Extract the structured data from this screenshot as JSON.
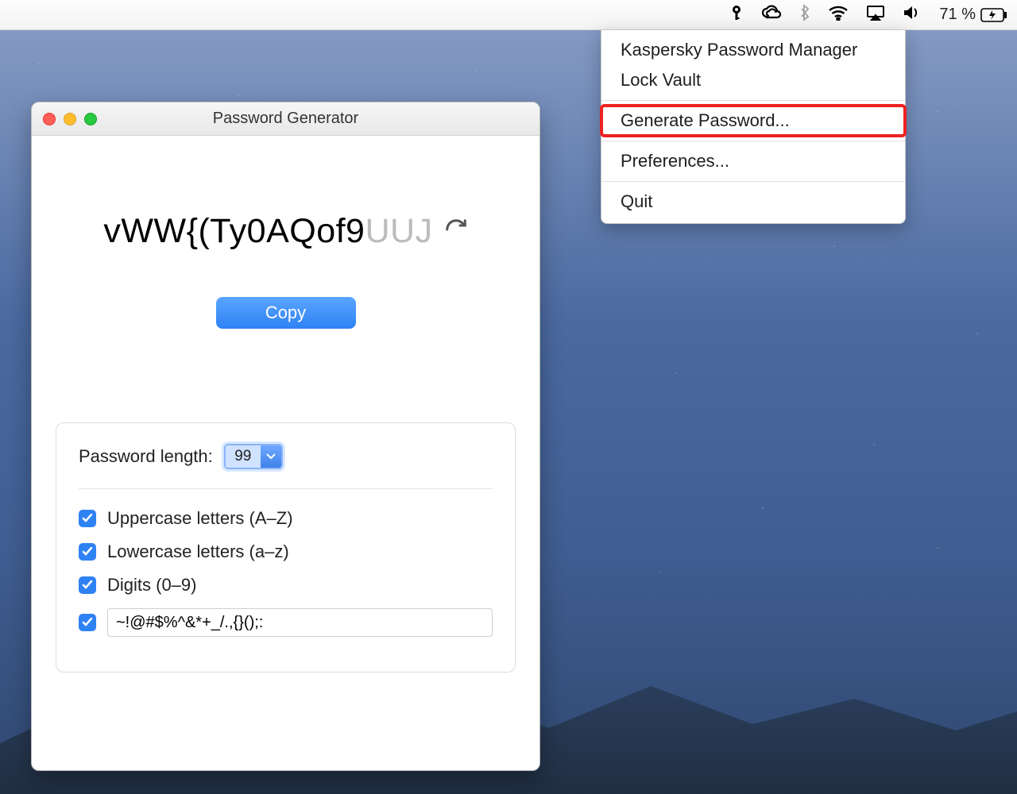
{
  "menubar": {
    "battery_text": "71 %"
  },
  "dropdown": {
    "header": "Kaspersky Password Manager",
    "lock": "Lock Vault",
    "generate": "Generate Password...",
    "prefs": "Preferences...",
    "quit": "Quit"
  },
  "window": {
    "title": "Password Generator",
    "password_visible": "vWW{(Ty0AQof9",
    "password_truncated": "UUJ",
    "copy_label": "Copy",
    "length_label": "Password length:",
    "length_value": "99",
    "opt_upper": "Uppercase letters (A–Z)",
    "opt_lower": "Lowercase letters (a–z)",
    "opt_digits": "Digits (0–9)",
    "special_chars": "~!@#$%^&*+_/.,{}();:"
  }
}
